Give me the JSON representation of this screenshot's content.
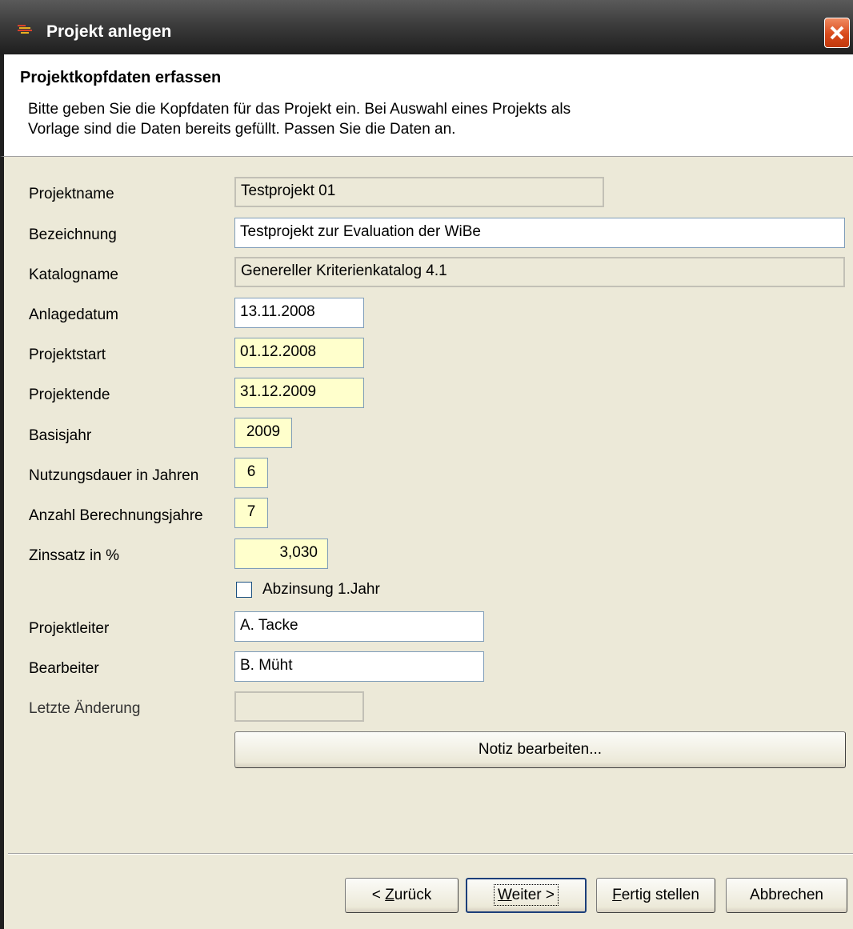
{
  "window": {
    "title": "Projekt anlegen",
    "close_icon": "close-icon",
    "app_icon": "app-icon"
  },
  "header": {
    "title": "Projektkopfdaten erfassen",
    "description_line1": "Bitte geben Sie die Kopfdaten für das Projekt ein. Bei Auswahl eines Projekts als",
    "description_line2": "Vorlage sind die Daten bereits gefüllt. Passen Sie die Daten an."
  },
  "form": {
    "projektname": {
      "label": "Projektname",
      "value": "Testprojekt 01"
    },
    "bezeichnung": {
      "label": "Bezeichnung",
      "value": "Testprojekt zur Evaluation der WiBe"
    },
    "katalogname": {
      "label": "Katalogname",
      "value": "Genereller Kriterienkatalog 4.1"
    },
    "anlagedatum": {
      "label": "Anlagedatum",
      "value": "13.11.2008"
    },
    "projektstart": {
      "label": "Projektstart",
      "value": "01.12.2008"
    },
    "projektende": {
      "label": "Projektende",
      "value": "31.12.2009"
    },
    "basisjahr": {
      "label": "Basisjahr",
      "value": "2009"
    },
    "nutzungsdauer": {
      "label": "Nutzungsdauer in Jahren",
      "value": "6"
    },
    "berechnungsjahre": {
      "label": "Anzahl Berechnungsjahre",
      "value": "7"
    },
    "zinssatz": {
      "label": "Zinssatz in %",
      "value": "3,030"
    },
    "abzinsung": {
      "label": "Abzinsung 1.Jahr",
      "checked": false
    },
    "projektleiter": {
      "label": "Projektleiter",
      "value": "A. Tacke"
    },
    "bearbeiter": {
      "label": "Bearbeiter",
      "value": "B. Müht"
    },
    "letzte_aenderung": {
      "label": "Letzte Änderung",
      "value": ""
    },
    "notiz_button": "Notiz bearbeiten..."
  },
  "footer": {
    "back_prefix": "< ",
    "back_mnemonic": "Z",
    "back_rest": "urück",
    "next_mnemonic": "W",
    "next_rest": "eiter >",
    "finish_mnemonic": "F",
    "finish_rest": "ertig stellen",
    "cancel": "Abbrechen"
  },
  "colors": {
    "required_field": "#ffffcc",
    "dialog_face": "#ece9d8",
    "close_button": "#d94a1c"
  }
}
